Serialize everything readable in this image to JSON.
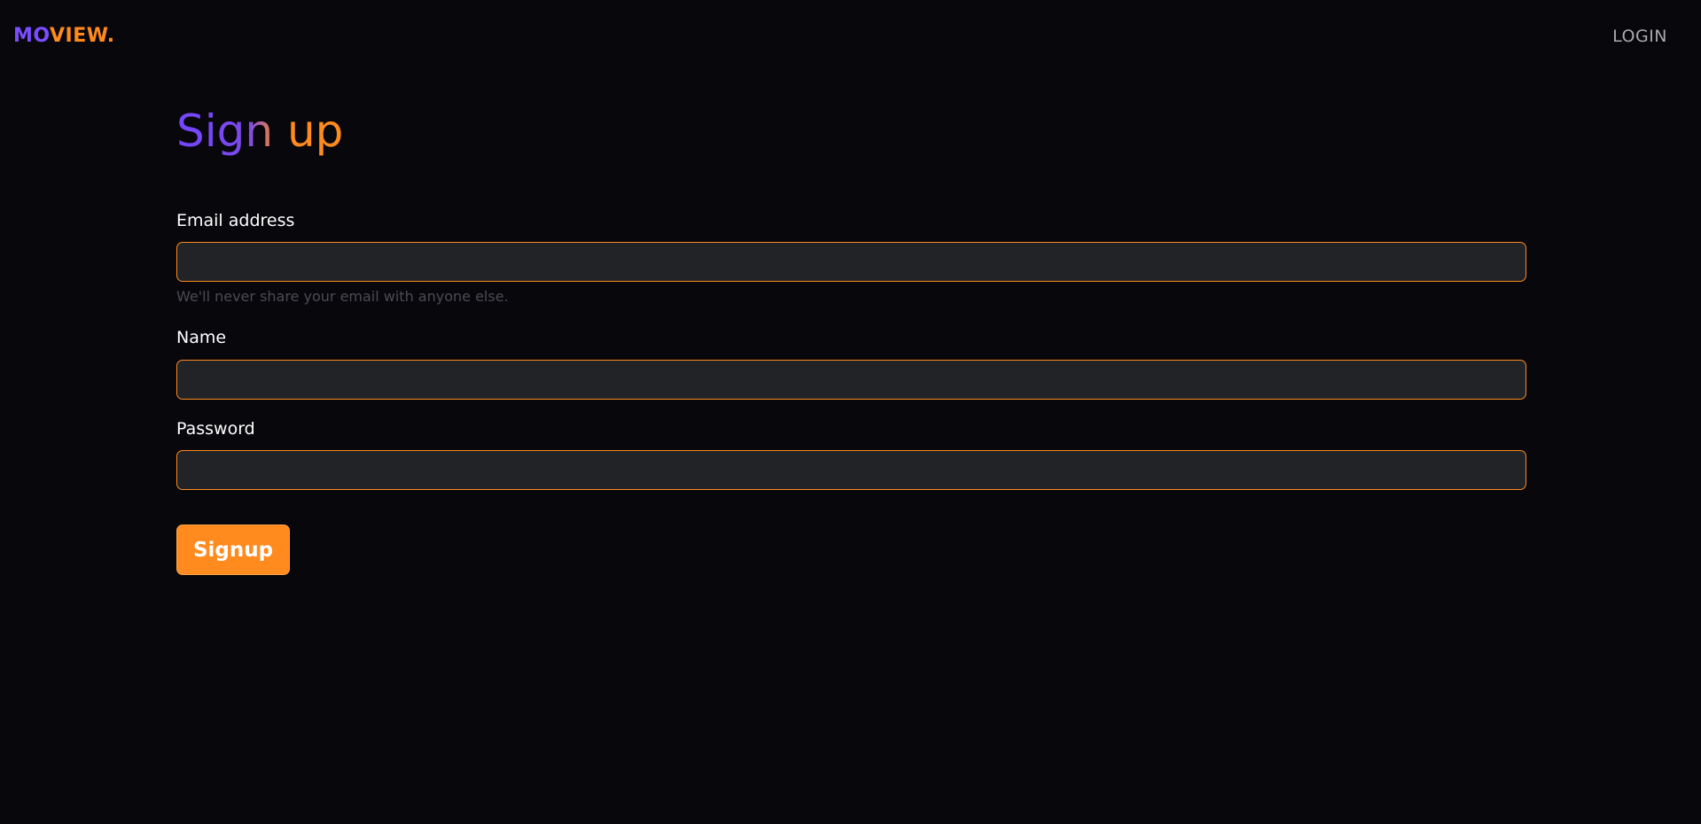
{
  "header": {
    "logo_part1": "MO",
    "logo_part2": "VIEW.",
    "login_label": "LOGIN"
  },
  "form": {
    "title": "Sign up",
    "email": {
      "label": "Email address",
      "value": "",
      "help": "We'll never share your email with anyone else."
    },
    "name": {
      "label": "Name",
      "value": ""
    },
    "password": {
      "label": "Password",
      "value": ""
    },
    "submit_label": "Signup"
  },
  "colors": {
    "background": "#08070c",
    "accent_purple": "#7b4dff",
    "accent_orange": "#ff8a1e",
    "input_background": "#212327"
  }
}
